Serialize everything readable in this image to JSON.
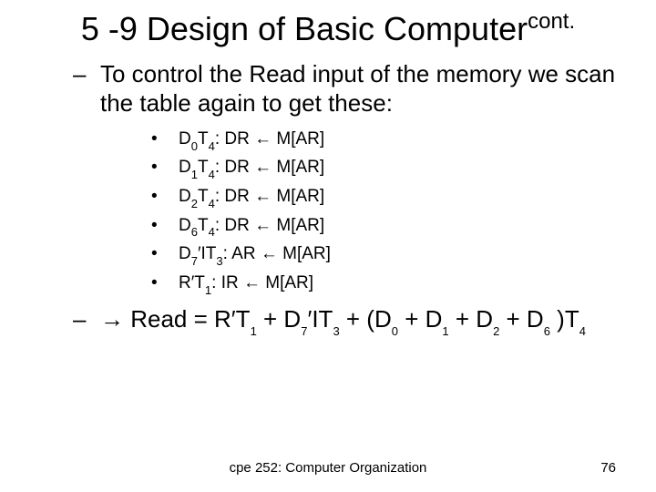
{
  "title_main": "5 -9 Design of Basic Computer",
  "title_sup": "cont.",
  "intro_dash": "–",
  "intro_text": "To control the Read input of the memory we scan the table again to get these:",
  "bullets": [
    {
      "dot": "•",
      "d": "D",
      "di": "0",
      "t": "T",
      "ti": "4",
      "sep": ": DR ",
      "arr": "←",
      "rhs": " M[AR]"
    },
    {
      "dot": "•",
      "d": "D",
      "di": "1",
      "t": "T",
      "ti": "4",
      "sep": ": DR ",
      "arr": "←",
      "rhs": " M[AR]"
    },
    {
      "dot": "•",
      "d": "D",
      "di": "2",
      "t": "T",
      "ti": "4",
      "sep": ": DR ",
      "arr": "←",
      "rhs": " M[AR]"
    },
    {
      "dot": "•",
      "d": "D",
      "di": "6",
      "t": "T",
      "ti": "4",
      "sep": ": DR ",
      "arr": "←",
      "rhs": " M[AR]"
    }
  ],
  "bullet5": {
    "dot": "•",
    "pre": "D",
    "di": "7",
    "prime": "′",
    "mid": "IT",
    "ti": "3",
    "sep": ": AR ",
    "arr": "←",
    "rhs": " M[AR]"
  },
  "bullet6": {
    "dot": "•",
    "pre": "R",
    "prime": "′",
    "t": "T",
    "ti": "1",
    "sep": ": IR ",
    "arr": "←",
    "rhs": " M[AR]"
  },
  "concl_dash": "–",
  "concl_arrow": "→",
  "concl_text_a": " Read = R",
  "concl_prime1": "′",
  "concl_T1": "T",
  "concl_T1i": "1",
  "concl_plus1": " + D",
  "concl_D7i": "7",
  "concl_prime2": "′",
  "concl_IT": "IT",
  "concl_IT3i": "3",
  "concl_plus2": " + (D",
  "concl_d0": "0",
  "concl_pd1": " + D",
  "concl_d1": "1",
  "concl_pd2": " + D",
  "concl_d2": "2",
  "concl_pd6": " + D",
  "concl_d6": "6",
  "concl_close": " )T",
  "concl_t4": "4",
  "footer_center": "cpe 252: Computer Organization",
  "footer_right": "76"
}
